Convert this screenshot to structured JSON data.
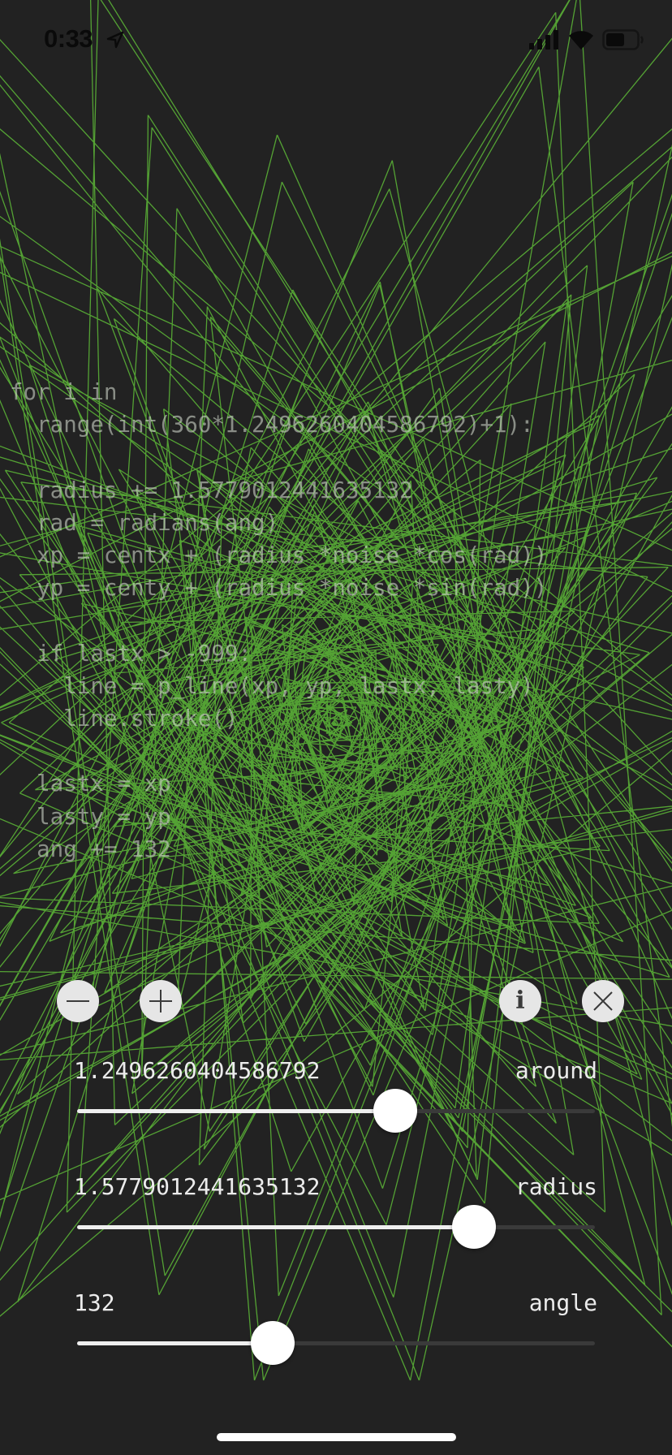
{
  "status_bar": {
    "time": "0:33",
    "icons": [
      "location-arrow-icon",
      "cellular-signal-icon",
      "wifi-icon",
      "battery-icon"
    ]
  },
  "background": {
    "description_colors": {
      "background": "#222222",
      "line": "#6ad83c"
    }
  },
  "code_lines": [
    "for i in",
    "  range(int(360*1.2496260404586792)+1):",
    "",
    "  radius += 1.5779012441635132",
    "  rad = radians(ang)",
    "  xp = centx + (radius *noise *cos(rad))",
    "  yp = centy + (radius *noise *sin(rad))",
    "",
    "  if lastx > -999:",
    "    line = p_line(xp, yp, lastx, lasty)",
    "    line.stroke()",
    "",
    "  lastx = xp",
    "  lasty = yp",
    "  ang += 132"
  ],
  "buttons": {
    "minus": "minus-icon",
    "plus": "plus-icon",
    "info": "i",
    "close": "close-icon"
  },
  "sliders": [
    {
      "value": "1.2496260404586792",
      "label": "around",
      "fraction": 0.615
    },
    {
      "value": "1.5779012441635132",
      "label": "radius",
      "fraction": 0.767
    },
    {
      "value": "132",
      "label": "angle",
      "fraction": 0.377
    }
  ],
  "colors": {
    "accent_line": "#6ad83c",
    "button_bg": "#e6e6e6"
  }
}
